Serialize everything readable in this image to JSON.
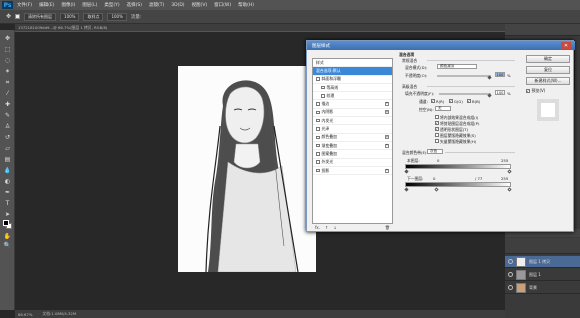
{
  "menubar": {
    "logo": "Ps",
    "items": [
      "文件(F)",
      "编辑(E)",
      "图像(I)",
      "图层(L)",
      "类型(Y)",
      "选择(S)",
      "滤镜(T)",
      "3D(D)",
      "视图(V)",
      "窗口(W)",
      "帮助(H)"
    ]
  },
  "options": {
    "sample": "取样点",
    "opacity": "100%",
    "flow": "100%",
    "label_a": "清除所有图层",
    "label_b": "流量:"
  },
  "document": {
    "tab": "1372181009dd9...@ 66.7%(图层 1 拷贝, RGB/8)",
    "status_zoom": "66.67%",
    "status_doc": "文档:1.08M/4.32M"
  },
  "dialog": {
    "title": "图层样式",
    "close": "✕",
    "styles": [
      {
        "label": "样式",
        "checkbox": false,
        "plus": false,
        "selected": false
      },
      {
        "label": "混合选项:默认",
        "checkbox": false,
        "plus": false,
        "selected": true
      },
      {
        "label": "斜面和浮雕",
        "checkbox": true,
        "plus": false,
        "selected": false
      },
      {
        "label": "等高线",
        "checkbox": true,
        "plus": false,
        "selected": false
      },
      {
        "label": "纹理",
        "checkbox": true,
        "plus": false,
        "selected": false
      },
      {
        "label": "描边",
        "checkbox": true,
        "plus": true,
        "selected": false
      },
      {
        "label": "内阴影",
        "checkbox": true,
        "plus": true,
        "selected": false
      },
      {
        "label": "内发光",
        "checkbox": true,
        "plus": false,
        "selected": false
      },
      {
        "label": "光泽",
        "checkbox": true,
        "plus": false,
        "selected": false
      },
      {
        "label": "颜色叠加",
        "checkbox": true,
        "plus": true,
        "selected": false
      },
      {
        "label": "渐变叠加",
        "checkbox": true,
        "plus": true,
        "selected": false
      },
      {
        "label": "图案叠加",
        "checkbox": true,
        "plus": false,
        "selected": false
      },
      {
        "label": "外发光",
        "checkbox": true,
        "plus": false,
        "selected": false
      },
      {
        "label": "投影",
        "checkbox": true,
        "plus": true,
        "selected": false
      }
    ],
    "footer": {
      "fx": "fx.",
      "up": "↑",
      "down": "↓",
      "trash": "🗑"
    },
    "blend": {
      "section_title": "混合选项",
      "general_title": "常规混合",
      "mode_label": "混合模式(D):",
      "mode_value": "颜色减淡",
      "opacity_label": "不透明度(O):",
      "opacity_value": "100",
      "percent": "%",
      "advanced_title": "高级混合",
      "fill_label": "填充不透明度(F):",
      "fill_value": "100",
      "channels_label": "通道:",
      "ch_r": "R(R)",
      "ch_g": "G(G)",
      "ch_b": "B(B)",
      "knockout_label": "挖空(N):",
      "knockout_value": "无",
      "checks": [
        "将内部效果混合成组(I)",
        "将剪贴图层混合成组(P)",
        "透明形状图层(T)",
        "图层蒙版隐藏效果(S)",
        "矢量蒙版隐藏效果(H)"
      ],
      "blendif_label": "混合颜色带(E):",
      "blendif_value": "灰色",
      "this_layer": "本图层:",
      "this_left": "0",
      "this_right": "255",
      "under_layer": "下一图层:",
      "under_left": "0",
      "under_mid": "/ 77",
      "under_right": "255"
    },
    "buttons": {
      "ok": "确定",
      "reset": "复位",
      "new_style": "新建样式(W)...",
      "preview": "预览(V)"
    }
  },
  "layers": [
    {
      "name": "图层 1 拷贝",
      "selected": true
    },
    {
      "name": "图层 1",
      "selected": false
    },
    {
      "name": "背景",
      "selected": false
    }
  ]
}
